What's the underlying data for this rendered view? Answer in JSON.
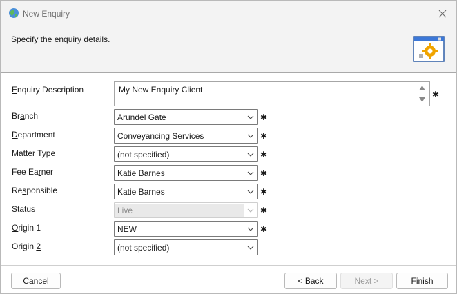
{
  "window": {
    "title": "New Enquiry",
    "close_icon": "close-icon",
    "app_icon": "globe-icon"
  },
  "header": {
    "instruction": "Specify the enquiry details.",
    "icon": "window-gear-icon"
  },
  "form": {
    "description": {
      "label": "Enquiry Description",
      "mnemonic": "E",
      "rest": "nquiry Description",
      "value": "My New Enquiry Client",
      "required": true
    },
    "branch": {
      "pre": "Br",
      "mnemonic": "a",
      "post": "nch",
      "value": "Arundel Gate",
      "required": true
    },
    "department": {
      "pre": "",
      "mnemonic": "D",
      "post": "epartment",
      "value": "Conveyancing Services",
      "required": true
    },
    "matter_type": {
      "pre": "",
      "mnemonic": "M",
      "post": "atter Type",
      "value": "(not specified)",
      "required": true
    },
    "fee_earner": {
      "pre": "Fee Ea",
      "mnemonic": "r",
      "post": "ner",
      "value": "Katie Barnes",
      "required": true
    },
    "responsible": {
      "pre": "Re",
      "mnemonic": "s",
      "post": "ponsible",
      "value": "Katie Barnes",
      "required": true
    },
    "status": {
      "pre": "S",
      "mnemonic": "t",
      "post": "atus",
      "value": "Live",
      "required": true,
      "disabled": true
    },
    "origin1": {
      "pre": "",
      "mnemonic": "O",
      "post": "rigin 1",
      "value": "NEW",
      "required": true
    },
    "origin2": {
      "pre": "Origin ",
      "mnemonic": "2",
      "post": "",
      "value": "(not specified)",
      "required": false
    },
    "required_marker": "✱"
  },
  "buttons": {
    "cancel": "Cancel",
    "back": "< Back",
    "next": "Next >",
    "finish": "Finish"
  }
}
